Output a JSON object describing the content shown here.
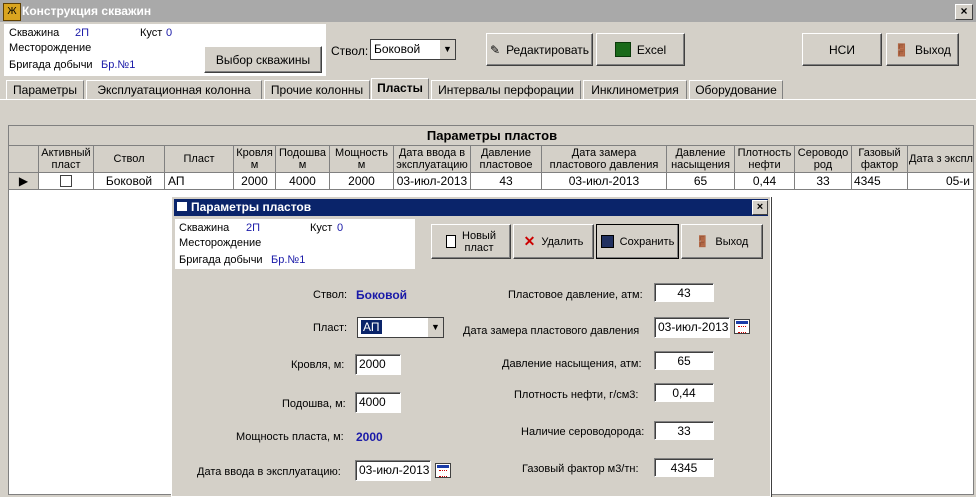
{
  "window": {
    "title": "Конструкция скважин"
  },
  "header": {
    "well_label": "Скважина",
    "well_value": "2П",
    "cluster_label": "Куст",
    "cluster_value": "0",
    "field_label": "Месторождение",
    "brigade_label": "Бригада добычи",
    "brigade_value": "Бр.№1",
    "select_well_button": "Выбор скважины",
    "trunk_label": "Ствол:",
    "trunk_value": "Боковой",
    "edit_button": "Редактировать",
    "excel_button": "Excel",
    "nsi_button": "НСИ",
    "exit_button": "Выход"
  },
  "tabs": [
    {
      "label": "Параметры"
    },
    {
      "label": "Эксплуатационная колонна"
    },
    {
      "label": "Прочие колонны"
    },
    {
      "label": "Пласты",
      "active": true
    },
    {
      "label": "Интервалы перфорации"
    },
    {
      "label": "Инклинометрия"
    },
    {
      "label": "Оборудование"
    }
  ],
  "grid": {
    "title": "Параметры пластов",
    "columns": [
      "Активный пласт",
      "Ствол",
      "Пласт",
      "Кровля м",
      "Подошва м",
      "Мощность м",
      "Дата ввода в эксплуатацию",
      "Давление пластовое",
      "Дата замера пластового давления",
      "Давление насыщения",
      "Плотность нефти",
      "Сероводо род",
      "Газовый фактор",
      "Дата з экспл"
    ],
    "row": {
      "active": false,
      "trunk": "Боковой",
      "layer": "АП",
      "top": "2000",
      "bottom": "4000",
      "thickness": "2000",
      "commission_date": "03-июл-2013",
      "pressure": "43",
      "pressure_date": "03-июл-2013",
      "saturation": "65",
      "density": "0,44",
      "h2s": "33",
      "gas_factor": "4345",
      "last": "05-и"
    }
  },
  "dialog": {
    "title": "Параметры пластов",
    "well_label": "Скважина",
    "well_value": "2П",
    "cluster_label": "Куст",
    "cluster_value": "0",
    "field_label": "Месторождение",
    "brigade_label": "Бригада добычи",
    "brigade_value": "Бр.№1",
    "new_layer_button_1": "Новый",
    "new_layer_button_2": "пласт",
    "delete_button": "Удалить",
    "save_button": "Сохранить",
    "exit_button": "Выход",
    "trunk_label": "Ствол:",
    "trunk_value": "Боковой",
    "layer_label": "Пласт:",
    "layer_value": "АП",
    "top_label": "Кровля, м:",
    "top_value": "2000",
    "bottom_label": "Подошва, м:",
    "bottom_value": "4000",
    "thickness_label": "Мощность пласта, м:",
    "thickness_value": "2000",
    "commission_label": "Дата ввода в эксплуатацию:",
    "commission_value": "03-июл-2013",
    "pressure_label": "Пластовое давление, атм:",
    "pressure_value": "43",
    "pressure_date_label": "Дата замера пластового давления",
    "pressure_date_value": "03-июл-2013",
    "saturation_label": "Давление насыщения, атм:",
    "saturation_value": "65",
    "density_label": "Плотность нефти, г/см3:",
    "density_value": "0,44",
    "h2s_label": "Наличие сероводорода:",
    "h2s_value": "33",
    "gas_label": "Газовый фактор м3/тн:",
    "gas_value": "4345"
  }
}
